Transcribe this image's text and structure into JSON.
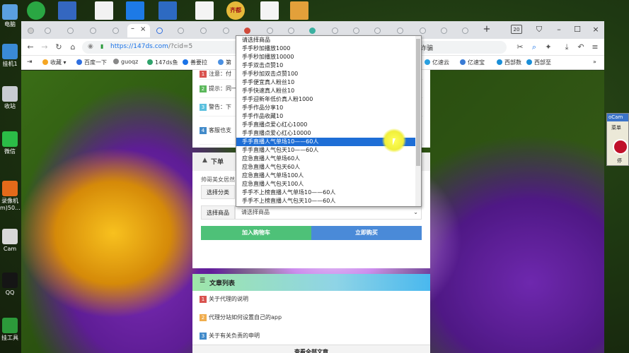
{
  "desktop": {
    "icons": [
      {
        "label": "电脑",
        "color": "#5aa0e0"
      },
      {
        "label": "挂机1",
        "color": "#3a8ad6"
      },
      {
        "label": "收站",
        "color": "#c9ccd2"
      },
      {
        "label": "微信",
        "color": "#2bbd47"
      },
      {
        "label": "录像机\nm)50...",
        "color": "#e46a1a"
      },
      {
        "label": "Cam",
        "color": "#d8d8d8"
      },
      {
        "label": "QQ",
        "color": "#151515"
      },
      {
        "label": "挂工具",
        "color": "#2c9a3a"
      }
    ],
    "top_icons": [
      "#2aa743",
      "#3467c0",
      "#f2f2f2",
      "#1d7ae6",
      "#2d6ac2",
      "#f4f4f4",
      "#e6b93a",
      "#f4f4f4",
      "#e3a03a"
    ],
    "top_badge": "齐都"
  },
  "browser": {
    "tab_count_badge": "20",
    "url_host": "https://147ds.com",
    "url_path": "/?cid=5",
    "url_right_text": "诈骗",
    "bookmarks": [
      {
        "label": "收藏",
        "color": "#f5a623"
      },
      {
        "label": "百度一下",
        "color": "#2f6fe0"
      },
      {
        "label": "guoqz",
        "color": "#888888"
      },
      {
        "label": "147ds鱼",
        "color": "#2fa36b"
      },
      {
        "label": "善要拉",
        "color": "#1a73e8"
      },
      {
        "label": "第",
        "color": "#4a90e2"
      },
      {
        "label": "亿速云",
        "color": "#2aa0e0"
      },
      {
        "label": "亿速宝",
        "color": "#3a7bd5"
      },
      {
        "label": "西部数",
        "color": "#1a8fd8"
      },
      {
        "label": "西部至",
        "color": "#1a8fd8"
      }
    ]
  },
  "notice": {
    "rows": [
      {
        "num": "1",
        "color": "#d9534f",
        "text": "注意：付"
      },
      {
        "num": "2",
        "color": "#5cb85c",
        "text": "提示：同一"
      },
      {
        "num": "3",
        "color": "#5bc0de",
        "text": "警告：下"
      },
      {
        "num": "4",
        "color": "#428bca",
        "text": "客服也支"
      }
    ]
  },
  "order": {
    "header": "下单",
    "desc": "帅哥美女居然",
    "category_label": "选择分类",
    "product_label": "选择商品",
    "product_value": "请选择商品",
    "add_cart": "加入购物车",
    "buy_now": "立即购买"
  },
  "dropdown": {
    "options": [
      "请选择商品",
      "手手秒加播放1000",
      "手手秒加播放10000",
      "手手双击点赞10",
      "手手秒加双击点赞100",
      "手手便宜真人粉丝10",
      "手手快速真人粉丝10",
      "手手迎新年低价真人粉1000",
      "手手作品分享10",
      "手手作品收藏10",
      "手手直播点爱心红心1000",
      "手手直播点爱心红心10000",
      "手手直播人气单场10——60人",
      "手手直播人气包天10——60人",
      "应急直播人气单场60人",
      "应急直播人气包天60人",
      "应急直播人气单场100人",
      "应急直播人气包天100人",
      "手手不上榜直播人气单场10——60人",
      "手手不上榜直播人气包天10——60人"
    ],
    "selected_index": 12
  },
  "articles": {
    "title": "文章列表",
    "items": [
      {
        "num": "1",
        "color": "#d9534f",
        "text": "关于代理的说明"
      },
      {
        "num": "2",
        "color": "#f0ad4e",
        "text": "代理分站如何设置自己的app"
      },
      {
        "num": "3",
        "color": "#428bca",
        "text": "关于有关负责的申明"
      }
    ],
    "view_all": "查看全部文章"
  },
  "ocam": {
    "title": "oCam",
    "menu": "菜单",
    "record": "停"
  }
}
